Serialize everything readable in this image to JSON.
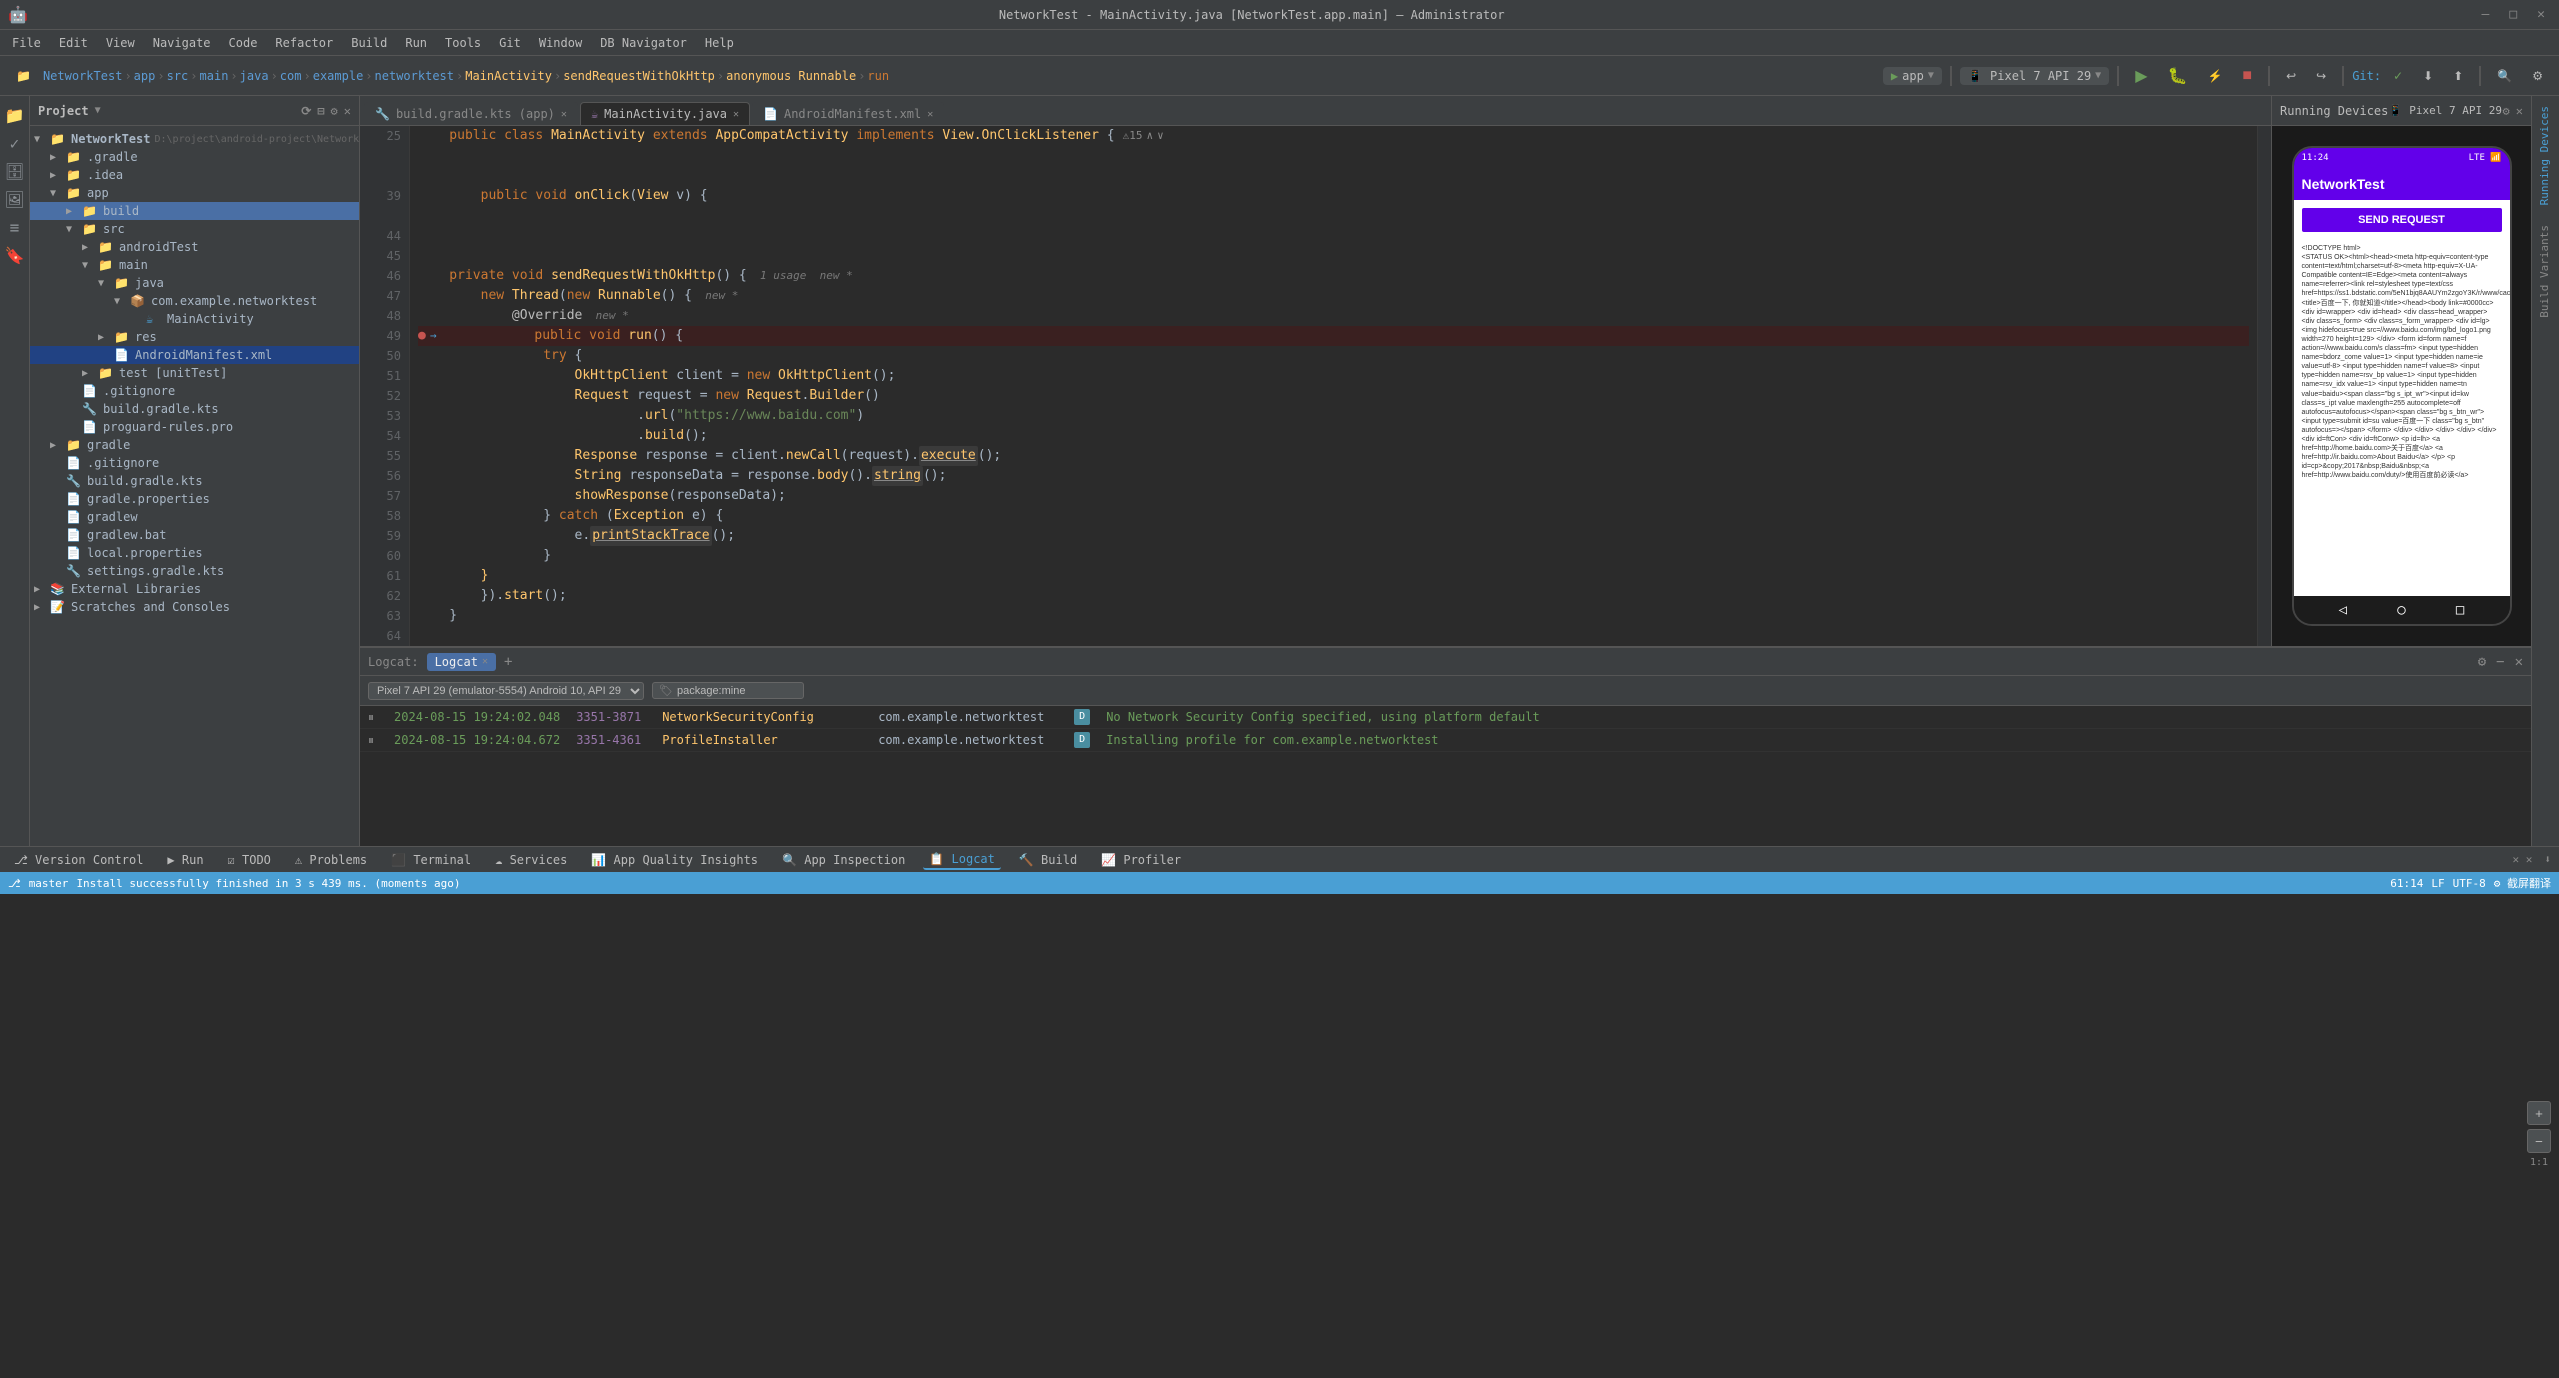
{
  "title_bar": {
    "title": "NetworkTest - MainActivity.java [NetworkTest.app.main] – Administrator",
    "close": "✕",
    "minimize": "–",
    "maximize": "□"
  },
  "menu": {
    "items": [
      "File",
      "Edit",
      "View",
      "Navigate",
      "Code",
      "Refactor",
      "Build",
      "Run",
      "Tools",
      "Git",
      "Window",
      "DB Navigator",
      "Help"
    ]
  },
  "toolbar": {
    "project": "NetworkTest",
    "breadcrumbs": [
      "NetworkTest",
      "app",
      "src",
      "main",
      "java",
      "com",
      "example",
      "networktest",
      "MainActivity",
      "sendRequestWithOkHttp",
      "anonymous Runnable",
      "run"
    ],
    "run_config": "app",
    "device": "Pixel 7 API 29",
    "git": "Git:",
    "branch": "master"
  },
  "project_panel": {
    "title": "Project",
    "root": "NetworkTest",
    "root_path": "D:\\project\\android-project\\NetworkTest",
    "items": [
      {
        "label": ".gradle",
        "indent": 1,
        "type": "folder",
        "expanded": false
      },
      {
        "label": ".idea",
        "indent": 1,
        "type": "folder",
        "expanded": false
      },
      {
        "label": "app",
        "indent": 1,
        "type": "folder",
        "expanded": true
      },
      {
        "label": "build",
        "indent": 2,
        "type": "folder",
        "expanded": false,
        "highlighted": true
      },
      {
        "label": "src",
        "indent": 2,
        "type": "folder",
        "expanded": true
      },
      {
        "label": "androidTest",
        "indent": 3,
        "type": "folder",
        "expanded": false
      },
      {
        "label": "main",
        "indent": 3,
        "type": "folder",
        "expanded": true
      },
      {
        "label": "java",
        "indent": 4,
        "type": "folder",
        "expanded": true
      },
      {
        "label": "com.example.networktest",
        "indent": 5,
        "type": "package",
        "expanded": true
      },
      {
        "label": "MainActivity",
        "indent": 6,
        "type": "kotlin",
        "expanded": false
      },
      {
        "label": "res",
        "indent": 4,
        "type": "folder",
        "expanded": false
      },
      {
        "label": "AndroidManifest.xml",
        "indent": 4,
        "type": "xml",
        "expanded": false,
        "selected": true
      },
      {
        "label": "test [unitTest]",
        "indent": 3,
        "type": "folder",
        "expanded": false
      },
      {
        "label": ".gitignore",
        "indent": 2,
        "type": "file",
        "expanded": false
      },
      {
        "label": "build.gradle.kts",
        "indent": 2,
        "type": "gradle",
        "expanded": false
      },
      {
        "label": "proguard-rules.pro",
        "indent": 2,
        "type": "file",
        "expanded": false
      },
      {
        "label": "gradle",
        "indent": 1,
        "type": "folder",
        "expanded": false
      },
      {
        "label": ".gitignore",
        "indent": 1,
        "type": "file"
      },
      {
        "label": "build.gradle.kts",
        "indent": 1,
        "type": "gradle"
      },
      {
        "label": "gradle.properties",
        "indent": 1,
        "type": "file"
      },
      {
        "label": "gradlew",
        "indent": 1,
        "type": "file"
      },
      {
        "label": "gradlew.bat",
        "indent": 1,
        "type": "file"
      },
      {
        "label": "local.properties",
        "indent": 1,
        "type": "file"
      },
      {
        "label": "settings.gradle.kts",
        "indent": 1,
        "type": "gradle"
      },
      {
        "label": "External Libraries",
        "indent": 0,
        "type": "folder",
        "expanded": false
      },
      {
        "label": "Scratches and Consoles",
        "indent": 0,
        "type": "folder",
        "expanded": false
      }
    ]
  },
  "editor_tabs": [
    {
      "label": "build.gradle.kts (app)",
      "type": "gradle",
      "active": false
    },
    {
      "label": "MainActivity.java",
      "type": "kotlin",
      "active": true
    },
    {
      "label": "AndroidManifest.xml",
      "type": "xml",
      "active": false
    }
  ],
  "code": {
    "lines": [
      {
        "num": 25,
        "content": "    public class MainActivity extends AppCompatActivity implements View.OnClickListener {",
        "type": "normal"
      },
      {
        "num": 39,
        "content": "        public void onClick(View v) {",
        "type": "normal"
      },
      {
        "num": 44,
        "content": "",
        "type": "normal"
      },
      {
        "num": 45,
        "content": "",
        "type": "normal"
      },
      {
        "num": 46,
        "content": "    private void sendRequestWithOkHttp() {  1 usage  new *",
        "type": "normal"
      },
      {
        "num": 47,
        "content": "        new Thread(new Runnable() {  new *",
        "type": "normal"
      },
      {
        "num": 48,
        "content": "            @Override  new *",
        "type": "normal"
      },
      {
        "num": 49,
        "content": "            public void run() {",
        "type": "breakpoint"
      },
      {
        "num": 50,
        "content": "                try {",
        "type": "normal"
      },
      {
        "num": 51,
        "content": "                    OkHttpClient client = new OkHttpClient();",
        "type": "normal"
      },
      {
        "num": 52,
        "content": "                    Request request = new Request.Builder()",
        "type": "normal"
      },
      {
        "num": 53,
        "content": "                            .url(\"https://www.baidu.com\")",
        "type": "normal"
      },
      {
        "num": 54,
        "content": "                            .build();",
        "type": "normal"
      },
      {
        "num": 55,
        "content": "                    Response response = client.newCall(request).execute();",
        "type": "normal"
      },
      {
        "num": 56,
        "content": "                    String responseData = response.body().string();",
        "type": "normal"
      },
      {
        "num": 57,
        "content": "                    showResponse(responseData);",
        "type": "normal"
      },
      {
        "num": 58,
        "content": "                } catch (Exception e) {",
        "type": "normal"
      },
      {
        "num": 59,
        "content": "                    e.printStackTrace();",
        "type": "normal"
      },
      {
        "num": 60,
        "content": "                }",
        "type": "normal"
      },
      {
        "num": 61,
        "content": "        }",
        "type": "normal"
      },
      {
        "num": 62,
        "content": "        }).start();",
        "type": "normal"
      },
      {
        "num": 63,
        "content": "    }",
        "type": "normal"
      },
      {
        "num": 64,
        "content": "",
        "type": "normal"
      }
    ]
  },
  "device_panel": {
    "title": "Running Devices",
    "device_name": "Pixel 7 API 29",
    "phone": {
      "time": "11:24",
      "signal": "LTE",
      "app_name": "NetworkTest",
      "send_btn": "SEND REQUEST",
      "response_text": "<!DOCTYPE html>\n<STATUS OK><html><head><meta http-equiv=content-type content=text/html;charset=utf-8><meta http-equiv=X-UA-Compatible content=IE=Edge><meta content=always name=referrer><link rel=stylesheet type=text/css href=https://ss1.bdstatic.com/5eN1bjq8AAUYm2zgoY3K/r/www/cache/bdorz/baidu.min.css><title>百度一下, 你就知道</title></head><body link=#0000cc> <div id=wrapper> <div id=head> <div class=head_wrapper> <div class=s_form> <div class=s_form_wrapper> <div id=lg> <img hidefocus=true src=//www.baidu.com/img/bd_logo1.png width=270 height=129> </div> <form id=form name=f action=//www.baidu.com/s class=fm> <input type=hidden name=bdorz_come value=1> <input type=hidden name=ie value=utf-8> <input type=hidden name=f value=8> <input type=hidden name=rsv_bp value=1> <input type=hidden name=rsv_idx value=1> <input type=hidden name=tn value=baidu><span class=\"bg s_ipt_wr\"><input id=kw class=s_ipt value maxlength=255 autocomplete=off autofocus=autofocus></span><span class=\"bg s_btn_wr\"><input type=submit id=su value=百度一下 class=\"bg s_btn\" autofocus=></span> </form> </div> </div> </div>"
    }
  },
  "logcat": {
    "title": "Logcat",
    "tabs": [
      {
        "label": "Logcat",
        "active": true
      }
    ],
    "filter_device": "Pixel 7 API 29 (emulator-5554) Android 10, API 29",
    "filter_package": "package:mine",
    "rows": [
      {
        "time": "2024-08-15 19:24:02.048",
        "pid": "3351-3871",
        "tag": "NetworkSecurityConfig",
        "pkg": "com.example.networktest",
        "level": "D",
        "msg": "No Network Security Config specified, using platform default"
      },
      {
        "time": "2024-08-15 19:24:04.672",
        "pid": "3351-4361",
        "tag": "ProfileInstaller",
        "pkg": "com.example.networktest",
        "level": "D",
        "msg": "Installing profile for com.example.networktest"
      }
    ]
  },
  "status_bar": {
    "left": "Install successfully finished in 3 s 439 ms. (moments ago)",
    "pos": "61:14",
    "encoding": "UTF-8",
    "line_sep": "LF",
    "branch": "master"
  },
  "bottom_tabs": [
    {
      "label": "Version Control",
      "active": false
    },
    {
      "label": "Run",
      "active": false
    },
    {
      "label": "TODO",
      "active": false
    },
    {
      "label": "Problems",
      "active": false
    },
    {
      "label": "Terminal",
      "active": false
    },
    {
      "label": "Services",
      "active": false
    },
    {
      "label": "App Quality Insights",
      "active": false
    },
    {
      "label": "App Inspection",
      "active": false
    },
    {
      "label": "Logcat",
      "active": true
    },
    {
      "label": "Build",
      "active": false
    },
    {
      "label": "Profiler",
      "active": false
    }
  ],
  "right_side_tabs": [
    {
      "label": "Running Devices"
    },
    {
      "label": "Build Variants"
    }
  ]
}
